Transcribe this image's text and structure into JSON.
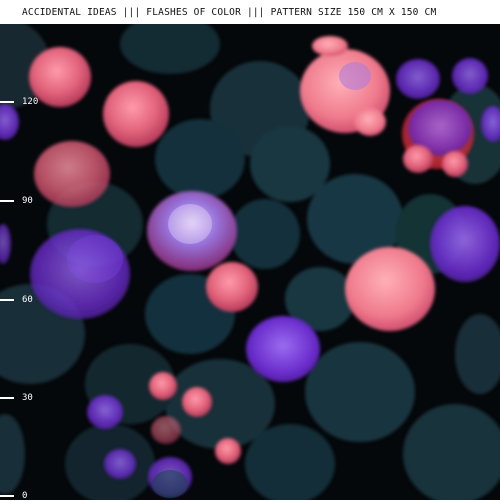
{
  "header": {
    "title": "ACCIDENTAL IDEAS ||| FLASHES OF COLOR ||| PATTERN SIZE 150 CM X 150 CM"
  },
  "ruler": {
    "ticks": [
      "120",
      "90",
      "60",
      "30",
      "0"
    ]
  },
  "colors": {
    "background": "#05080b",
    "teal": "#1d3a44",
    "pink": "#e66a80",
    "purple": "#7a3ad8",
    "red": "#d8303a"
  }
}
